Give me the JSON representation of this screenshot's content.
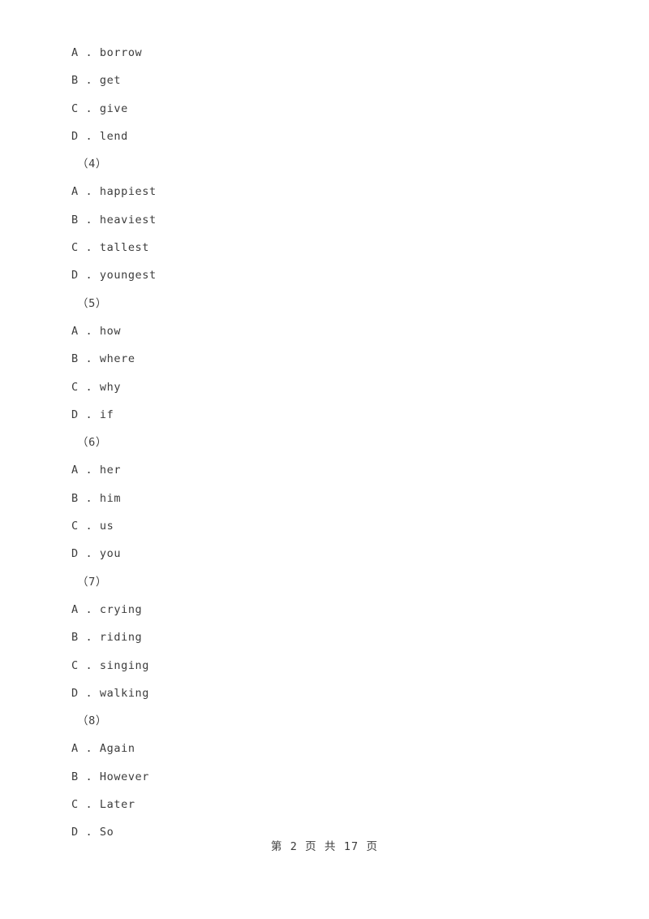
{
  "document": {
    "page_background": "#ffffff",
    "text_color": "#3c3c3c",
    "blocks": [
      {
        "question_number": null,
        "options": [
          {
            "letter": "A",
            "separator": ".",
            "text": "borrow",
            "line": "A . borrow"
          },
          {
            "letter": "B",
            "separator": ".",
            "text": "get",
            "line": "B . get"
          },
          {
            "letter": "C",
            "separator": ".",
            "text": "give",
            "line": "C . give"
          },
          {
            "letter": "D",
            "separator": ".",
            "text": "lend",
            "line": "D . lend"
          }
        ]
      },
      {
        "question_number": "（4）",
        "options": [
          {
            "letter": "A",
            "separator": ".",
            "text": "happiest",
            "line": "A . happiest"
          },
          {
            "letter": "B",
            "separator": ".",
            "text": "heaviest",
            "line": "B . heaviest"
          },
          {
            "letter": "C",
            "separator": ".",
            "text": "tallest",
            "line": "C . tallest"
          },
          {
            "letter": "D",
            "separator": ".",
            "text": "youngest",
            "line": "D . youngest"
          }
        ]
      },
      {
        "question_number": "（5）",
        "options": [
          {
            "letter": "A",
            "separator": ".",
            "text": "how",
            "line": "A . how"
          },
          {
            "letter": "B",
            "separator": ".",
            "text": "where",
            "line": "B . where"
          },
          {
            "letter": "C",
            "separator": ".",
            "text": "why",
            "line": "C . why"
          },
          {
            "letter": "D",
            "separator": ".",
            "text": "if",
            "line": "D . if"
          }
        ]
      },
      {
        "question_number": "（6）",
        "options": [
          {
            "letter": "A",
            "separator": ".",
            "text": "her",
            "line": "A . her"
          },
          {
            "letter": "B",
            "separator": ".",
            "text": "him",
            "line": "B . him"
          },
          {
            "letter": "C",
            "separator": ".",
            "text": "us",
            "line": "C . us"
          },
          {
            "letter": "D",
            "separator": ".",
            "text": "you",
            "line": "D . you"
          }
        ]
      },
      {
        "question_number": "（7）",
        "options": [
          {
            "letter": "A",
            "separator": ".",
            "text": "crying",
            "line": "A . crying"
          },
          {
            "letter": "B",
            "separator": ".",
            "text": "riding",
            "line": "B . riding"
          },
          {
            "letter": "C",
            "separator": ".",
            "text": "singing",
            "line": "C . singing"
          },
          {
            "letter": "D",
            "separator": ".",
            "text": "walking",
            "line": "D . walking"
          }
        ]
      },
      {
        "question_number": "（8）",
        "options": [
          {
            "letter": "A",
            "separator": ".",
            "text": "Again",
            "line": "A . Again"
          },
          {
            "letter": "B",
            "separator": ".",
            "text": "However",
            "line": "B . However"
          },
          {
            "letter": "C",
            "separator": ".",
            "text": "Later",
            "line": "C . Later"
          },
          {
            "letter": "D",
            "separator": ".",
            "text": "So",
            "line": "D . So"
          }
        ]
      }
    ],
    "lines": [
      "A . borrow",
      "B . get",
      "C . give",
      "D . lend",
      "（4）",
      "A . happiest",
      "B . heaviest",
      "C . tallest",
      "D . youngest",
      "（5）",
      "A . how",
      "B . where",
      "C . why",
      "D . if",
      "（6）",
      "A . her",
      "B . him",
      "C . us",
      "D . you",
      "（7）",
      "A . crying",
      "B . riding",
      "C . singing",
      "D . walking",
      "（8）",
      "A . Again",
      "B . However",
      "C . Later",
      "D . So"
    ]
  },
  "footer": {
    "text": "第 2 页 共 17 页",
    "current_page": "2",
    "total_pages": "17"
  }
}
